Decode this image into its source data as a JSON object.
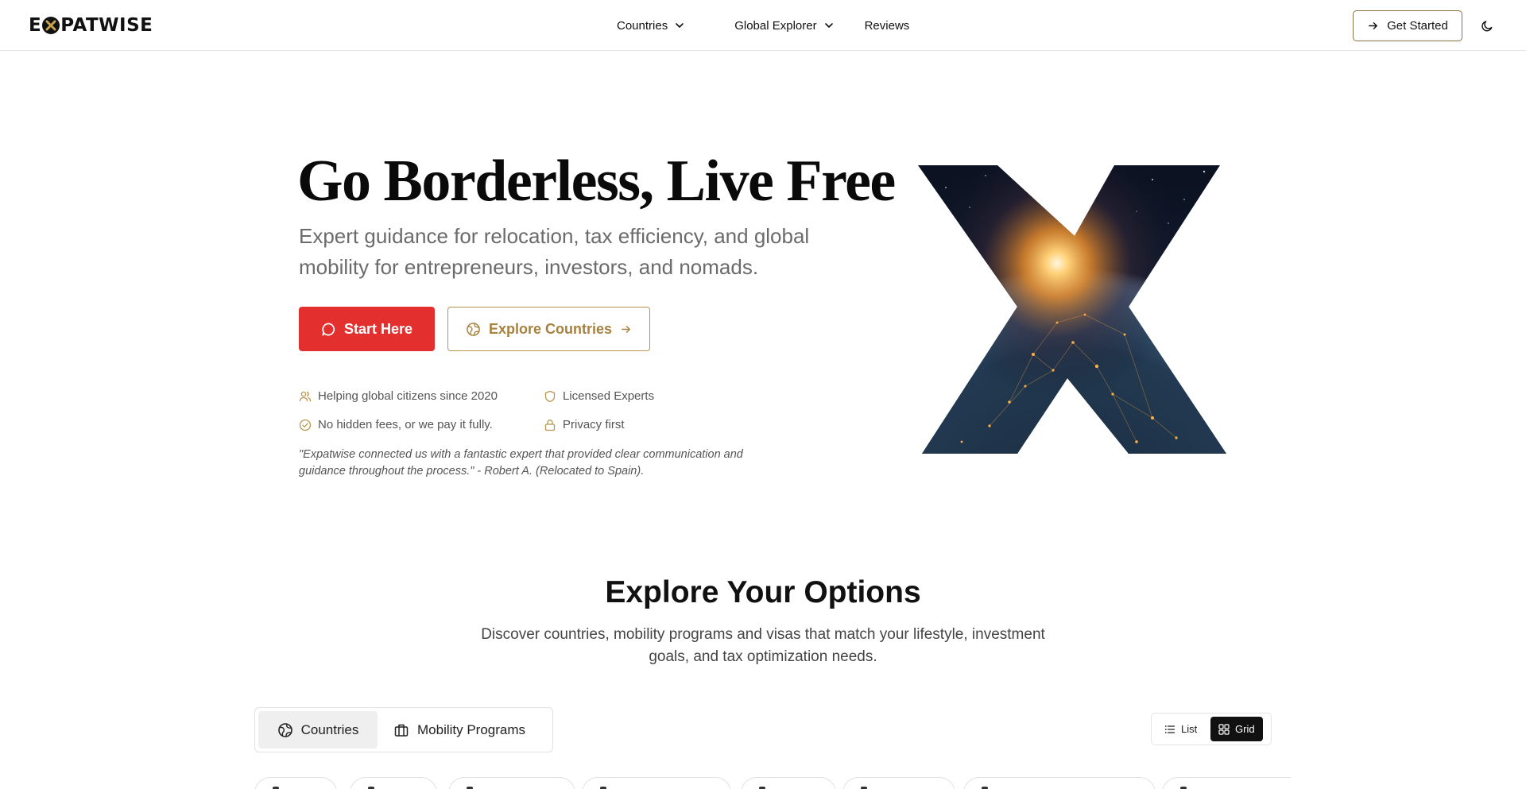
{
  "brand": {
    "logo_left": "E",
    "logo_right": "PATWISE",
    "logo_aria": "EXPATWISE"
  },
  "nav": {
    "items": [
      {
        "label": "Countries",
        "has_dropdown": true
      },
      {
        "label": "Global Explorer",
        "has_dropdown": true
      },
      {
        "label": "Reviews",
        "has_dropdown": false
      }
    ],
    "cta_label": "Get Started",
    "theme_icon": "moon-icon"
  },
  "hero": {
    "title": "Go Borderless, Live Free",
    "subtitle": "Expert guidance for relocation, tax efficiency, and global mobility for entrepreneurs, investors, and nomads.",
    "primary_cta": "Start Here",
    "secondary_cta": "Explore Countries",
    "features": [
      {
        "icon": "users-icon",
        "label": "Helping global citizens since 2020"
      },
      {
        "icon": "shield-icon",
        "label": "Licensed Experts"
      },
      {
        "icon": "check-circle-icon",
        "label": "No hidden fees, or we pay it fully."
      },
      {
        "icon": "lock-icon",
        "label": "Privacy first"
      }
    ],
    "testimonial": "\"Expatwise connected us with a fantastic expert that provided clear communication and guidance throughout the process.\" - Robert A. (Relocated to Spain)."
  },
  "explore": {
    "title": "Explore Your Options",
    "subtitle": "Discover countries, mobility programs and visas that match your lifestyle, investment goals, and tax optimization needs.",
    "tabs": [
      {
        "label": "Countries",
        "icon": "globe-icon",
        "active": true
      },
      {
        "label": "Mobility Programs",
        "icon": "briefcase-icon",
        "active": false
      }
    ],
    "view_modes": [
      {
        "label": "List",
        "icon": "list-icon",
        "active": false
      },
      {
        "label": "Grid",
        "icon": "grid-icon",
        "active": true
      }
    ]
  },
  "colors": {
    "primary_red": "#e42f2f",
    "accent_gold": "#a6813f",
    "text_dark": "#0a0a0a",
    "text_muted": "#6b6b6b"
  }
}
